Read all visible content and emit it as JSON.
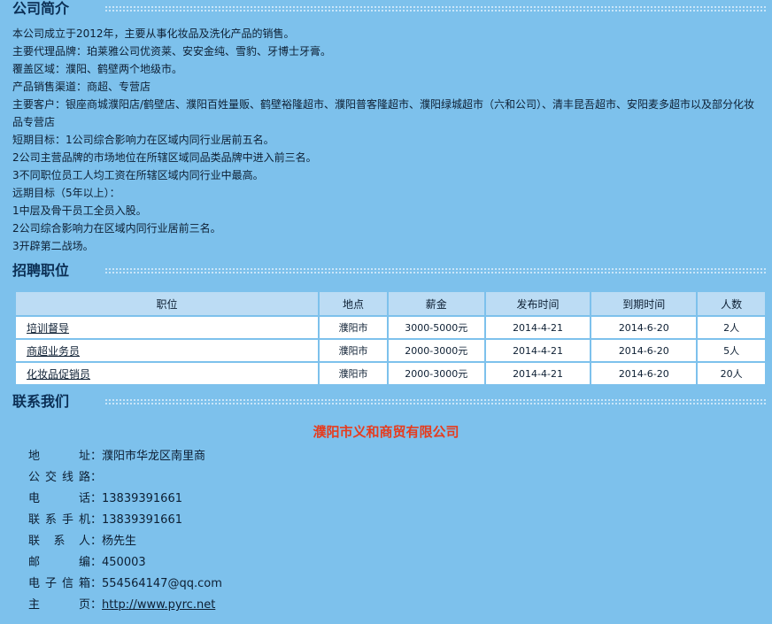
{
  "intro": {
    "title": "公司简介",
    "lines": [
      "本公司成立于2012年，主要从事化妆品及洗化产品的销售。",
      "主要代理品牌：珀莱雅公司优资莱、安安金纯、雪豹、牙博士牙膏。",
      "覆盖区域：濮阳、鹤壁两个地级市。",
      "产品销售渠道：商超、专营店",
      "主要客户：银座商城濮阳店/鹤壁店、濮阳百姓量贩、鹤壁裕隆超市、濮阳普客隆超市、濮阳绿城超市（六和公司）、清丰昆吾超市、安阳麦多超市以及部分化妆",
      "品专营店",
      "短期目标：1公司综合影响力在区域内同行业居前五名。",
      "2公司主营品牌的市场地位在所辖区域同品类品牌中进入前三名。",
      "3不同职位员工人均工资在所辖区域内同行业中最高。",
      "远期目标（5年以上）：",
      "1中层及骨干员工全员入股。",
      "2公司综合影响力在区域内同行业居前三名。",
      "3开辟第二战场。"
    ]
  },
  "jobs": {
    "title": "招聘职位",
    "headers": [
      "职位",
      "地点",
      "薪金",
      "发布时间",
      "到期时间",
      "人数"
    ],
    "rows": [
      [
        "培训督导",
        "濮阳市",
        "3000-5000元",
        "2014-4-21",
        "2014-6-20",
        "2人"
      ],
      [
        "商超业务员",
        "濮阳市",
        "2000-3000元",
        "2014-4-21",
        "2014-6-20",
        "5人"
      ],
      [
        "化妆品促销员",
        "濮阳市",
        "2000-3000元",
        "2014-4-21",
        "2014-6-20",
        "20人"
      ]
    ]
  },
  "contact": {
    "title": "联系我们",
    "company": "濮阳市义和商贸有限公司",
    "rows": [
      {
        "label": "地　　址",
        "value": "濮阳市华龙区南里商"
      },
      {
        "label": "公交线路",
        "value": ""
      },
      {
        "label": "电　　话",
        "value": "13839391661"
      },
      {
        "label": "联系手机",
        "value": "13839391661"
      },
      {
        "label": "联 系 人",
        "value": "杨先生"
      },
      {
        "label": "邮　　编",
        "value": "450003"
      },
      {
        "label": "电子信箱",
        "value": "554564147@qq.com"
      },
      {
        "label": "主　　页",
        "value": "http://www.pyrc.net"
      }
    ]
  }
}
